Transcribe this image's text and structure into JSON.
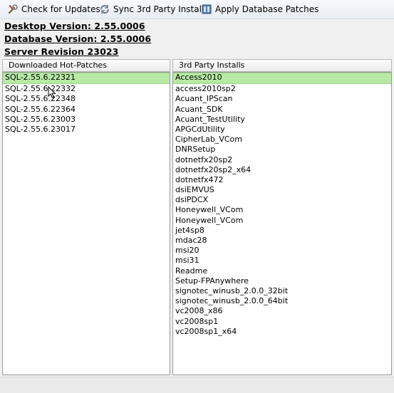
{
  "toolbar": {
    "check_updates": {
      "label": "Check for Updates",
      "icon": "wrench-icon"
    },
    "sync_installs": {
      "label": "Sync 3rd Party Installs",
      "icon": "sync-icon"
    },
    "apply_patches": {
      "label": "Apply Database Patches",
      "icon": "database-patch-icon"
    }
  },
  "info": {
    "desktop_version": "Desktop Version: 2.55.0006",
    "database_version": "Database Version: 2.55.0006",
    "server_revision": "Server Revision 23023"
  },
  "hotpatches": {
    "header": "Downloaded Hot-Patches",
    "items": [
      "SQL-2.55.6.22321",
      "SQL-2.55.6.22332",
      "SQL-2.55.6.22348",
      "SQL-2.55.6.22364",
      "SQL-2.55.6.23003",
      "SQL-2.55.6.23017"
    ],
    "selected_index": 0
  },
  "installs": {
    "header": "3rd Party Installs",
    "items": [
      "Access2010",
      "access2010sp2",
      "Acuant_IPScan",
      "Acuant_SDK",
      "Acuant_TestUtility",
      "APGCdUtility",
      "CipherLab_VCom",
      "DNRSetup",
      "dotnetfx20sp2",
      "dotnetfx20sp2_x64",
      "dotnetfx472",
      "dsiEMVUS",
      "dsiPDCX",
      "Honeywell_VCom",
      "Honeywell_VCom",
      "jet4sp8",
      "mdac28",
      "msi20",
      "msi31",
      "Readme",
      "Setup-FPAnywhere",
      "signotec_winusb_2.0.0_32bit",
      "signotec_winusb_2.0.0_64bit",
      "vc2008_x86",
      "vc2008sp1",
      "vc2008sp1_x64"
    ],
    "selected_index": 0
  },
  "colors": {
    "selection": "#b7e9a5",
    "toolbar_bg": "#eef2f7"
  }
}
